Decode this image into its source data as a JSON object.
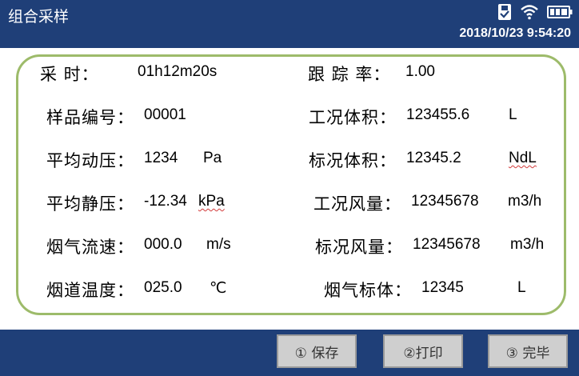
{
  "header": {
    "title": "组合采样",
    "datetime": "2018/10/23 9:54:20",
    "icons": [
      "usb-drive-icon",
      "wifi-icon",
      "battery-icon"
    ]
  },
  "fields": {
    "sample_time_label": "采      时：",
    "sample_time_value": "01h12m20s",
    "tracking_rate_label": "跟 踪 率：",
    "tracking_rate_value": "1.00",
    "sample_no_label": "样品编号：",
    "sample_no_value": "00001",
    "work_volume_label": "工况体积：",
    "work_volume_value": "123455.6",
    "work_volume_unit": "L",
    "avg_dyn_pressure_label": "平均动压：",
    "avg_dyn_pressure_value": "1234",
    "avg_dyn_pressure_unit": "Pa",
    "std_volume_label": "标况体积：",
    "std_volume_value": "12345.2",
    "std_volume_unit": "NdL",
    "avg_static_pressure_label": "平均静压：",
    "avg_static_pressure_value": "-12.34",
    "avg_static_pressure_unit": "kPa",
    "work_flow_label": "工况风量：",
    "work_flow_value": "12345678",
    "work_flow_unit": "m3/h",
    "flue_velocity_label": "烟气流速：",
    "flue_velocity_value": "000.0",
    "flue_velocity_unit": "m/s",
    "std_flow_label": "标况风量：",
    "std_flow_value": "12345678",
    "std_flow_unit": "m3/h",
    "flue_temp_label": "烟道温度：",
    "flue_temp_value": "025.0",
    "flue_temp_unit": "℃",
    "flue_std_volume_label": "烟气标体：",
    "flue_std_volume_value": "12345",
    "flue_std_volume_unit": "L"
  },
  "buttons": {
    "save": "① 保存",
    "print": "②打印",
    "finish": "③ 完毕"
  },
  "colors": {
    "header_bg": "#1f3f78",
    "panel_border": "#9dbb6a",
    "button_bg": "#cfcfcf"
  }
}
